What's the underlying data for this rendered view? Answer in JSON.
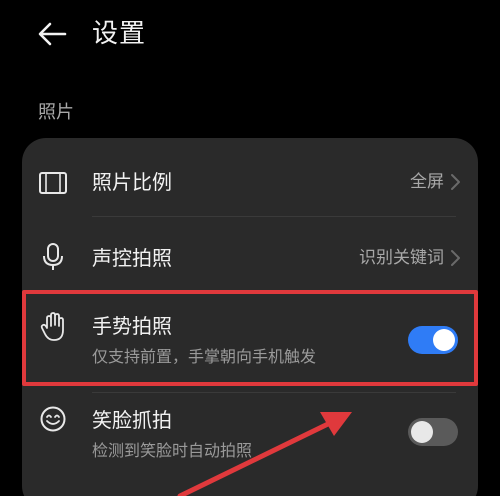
{
  "header": {
    "title": "设置",
    "back_icon": "arrow-left-icon"
  },
  "section": {
    "label": "照片"
  },
  "rows": [
    {
      "label": "照片比例",
      "value": "全屏",
      "icon": "aspect-ratio-icon"
    },
    {
      "label": "声控拍照",
      "value": "识别关键词",
      "icon": "microphone-icon"
    },
    {
      "label": "手势拍照",
      "sub": "仅支持前置，手掌朝向手机触发",
      "icon": "hand-icon",
      "toggle_on": true
    },
    {
      "label": "笑脸抓拍",
      "sub": "检测到笑脸时自动拍照",
      "icon": "smile-icon",
      "toggle_on": false
    }
  ],
  "colors": {
    "accent": "#2f7cf6",
    "highlight": "#e0393c",
    "card": "#2a2a2a"
  }
}
